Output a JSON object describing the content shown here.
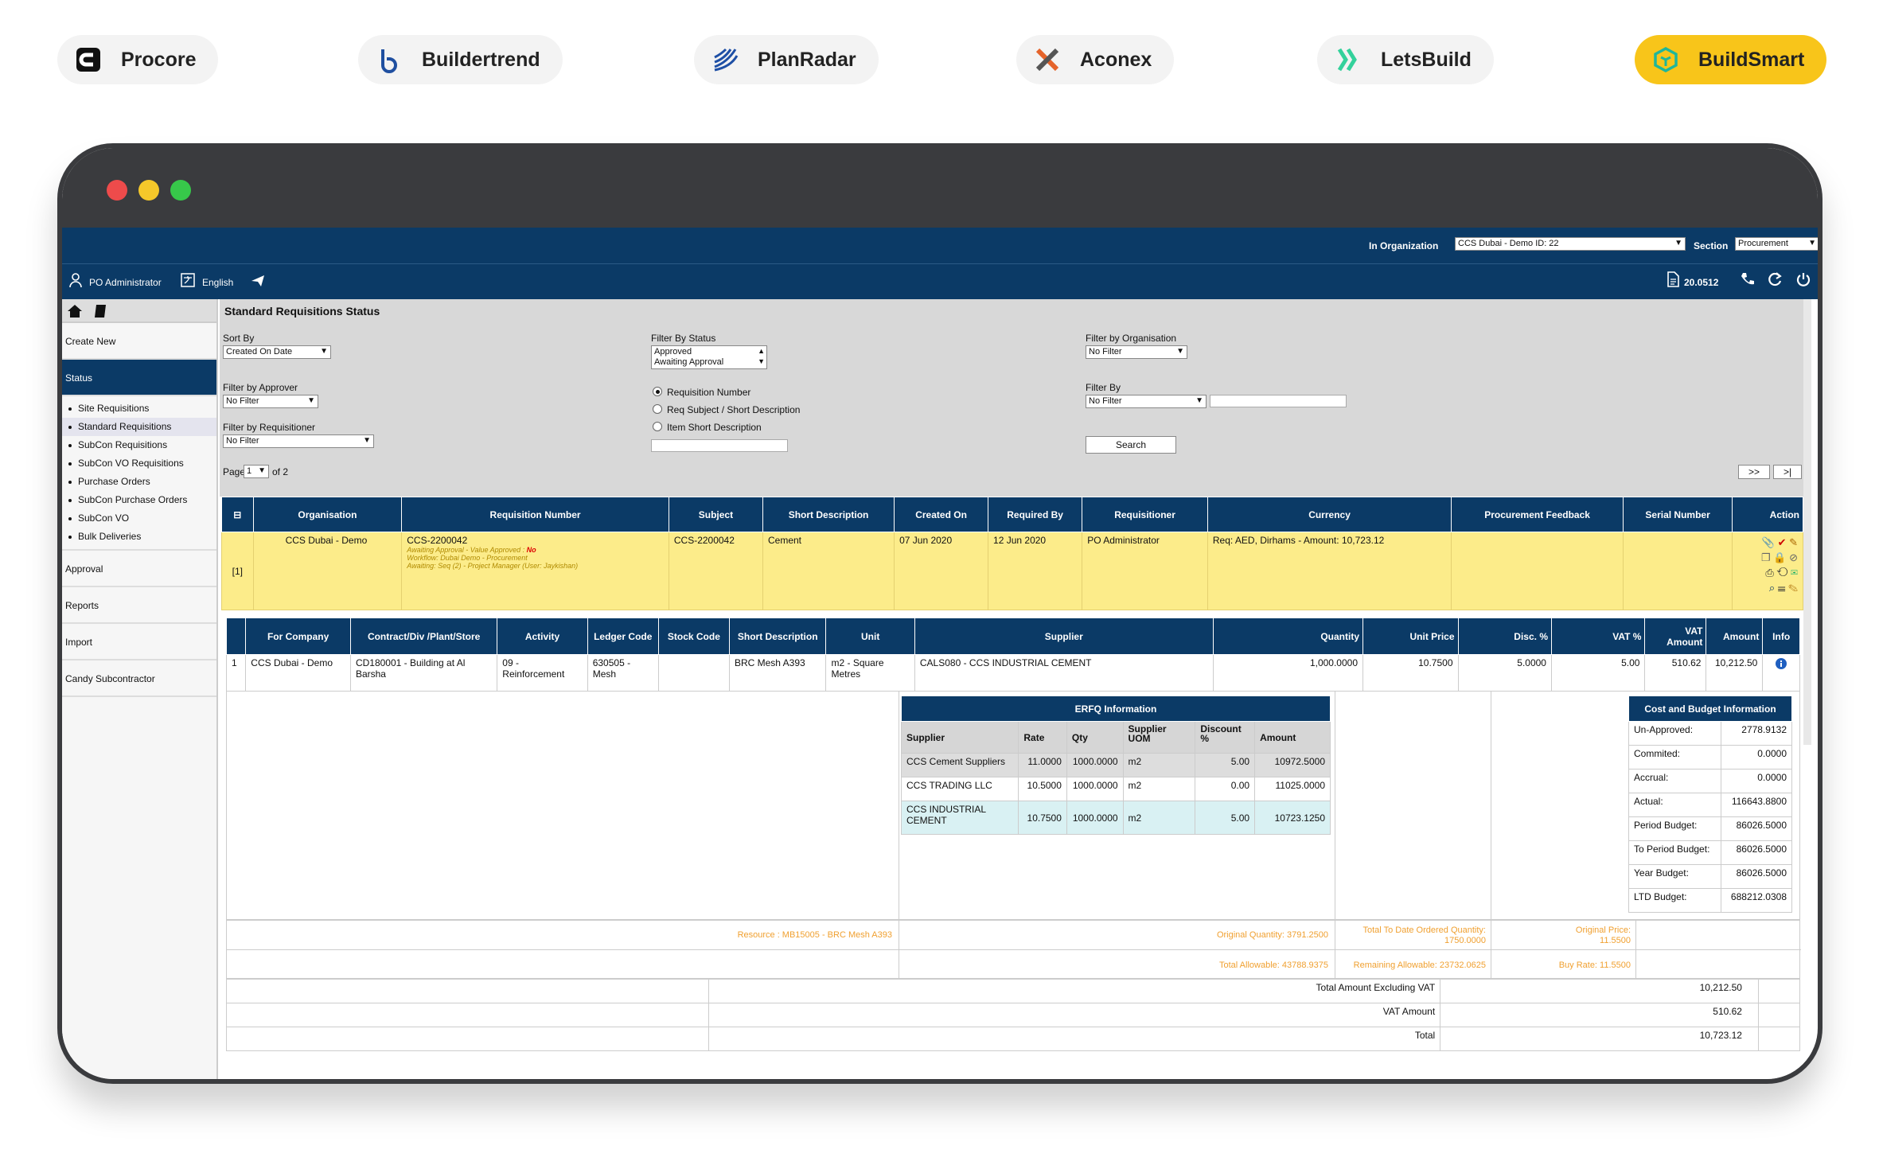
{
  "top_tabs": [
    {
      "label": "Procore",
      "color": "#111111",
      "icon": "procore-logo-icon"
    },
    {
      "label": "Buildertrend",
      "color": "#1f4fa0",
      "icon": "buildertrend-logo-icon"
    },
    {
      "label": "PlanRadar",
      "color": "#1e4fa5",
      "icon": "planradar-logo-icon"
    },
    {
      "label": "Aconex",
      "color": "#e5632a",
      "icon": "aconex-logo-icon"
    },
    {
      "label": "LetsBuild",
      "color": "#33d19b",
      "icon": "letsbuild-logo-icon"
    },
    {
      "label": "BuildSmart",
      "color": "#1fb69a",
      "icon": "buildsmart-logo-icon",
      "active": true
    }
  ],
  "orgbar": {
    "org_label": "In Organization",
    "org_value": "CCS Dubai - Demo ID: 22",
    "section_label": "Section",
    "section_value": "Procurement"
  },
  "userbar": {
    "user": "PO Administrator",
    "language": "English",
    "version": "20.0512"
  },
  "sidebar": {
    "create_new": "Create New",
    "status": "Status",
    "subs": [
      "Site Requisitions",
      "Standard Requisitions",
      "SubCon Requisitions",
      "SubCon VO Requisitions",
      "Purchase Orders",
      "SubCon Purchase Orders",
      "SubCon VO",
      "Bulk Deliveries"
    ],
    "approval": "Approval",
    "reports": "Reports",
    "import": "Import",
    "candy": "Candy Subcontractor"
  },
  "page_title": "Standard Requisitions Status",
  "filters": {
    "sort_by_label": "Sort By",
    "sort_by_value": "Created On Date",
    "filter_status_label": "Filter By Status",
    "status_options": [
      "Approved",
      "Awaiting Approval"
    ],
    "filter_org_label": "Filter by Organisation",
    "filter_org_value": "No Filter",
    "filter_approver_label": "Filter by Approver",
    "filter_approver_value": "No Filter",
    "radio1": "Requisition Number",
    "radio2": "Req Subject / Short Description",
    "radio3": "Item Short Description",
    "filter_by_label": "Filter By",
    "filter_by_value": "No Filter",
    "filter_req_label": "Filter by Requisitioner",
    "filter_req_value": "No Filter",
    "search": "Search",
    "page_label": "Page",
    "page_value": "1",
    "page_of": "of 2",
    "next": ">>",
    "last": ">|"
  },
  "main_table": {
    "headers": [
      "Organisation",
      "Requisition Number",
      "Subject",
      "Short Description",
      "Created On",
      "Required By",
      "Requisitioner",
      "Currency",
      "Procurement Feedback",
      "Serial Number",
      "Action"
    ],
    "row": {
      "index": "[1]",
      "org": "CCS Dubai - Demo",
      "req_no": "CCS-2200042",
      "status_line": "Awaiting Approval - Value Approved : ",
      "status_no": "No",
      "workflow": "Workflow: Dubai Demo - Procurement",
      "awaiting": "Awaiting: Seq (2) - Project Manager (User: Jaykishan)",
      "subject": "CCS-2200042",
      "short_desc": "Cement",
      "created": "07 Jun 2020",
      "required": "12 Jun 2020",
      "requisitioner": "PO Administrator",
      "currency": "Req: AED, Dirhams - Amount: 10,723.12"
    }
  },
  "items_table": {
    "headers": [
      "For Company",
      "Contract/Div /Plant/Store",
      "Activity",
      "Ledger Code",
      "Stock Code",
      "Short Description",
      "Unit",
      "Supplier",
      "Quantity",
      "Unit Price",
      "Disc. %",
      "VAT %",
      "VAT Amount",
      "Amount",
      "Info"
    ],
    "row": [
      "1",
      "CCS Dubai - Demo",
      "CD180001 - Building at Al Barsha",
      "09 - Reinforcement",
      "630505 - Mesh",
      "",
      "BRC Mesh A393",
      "m2 - Square Metres",
      "CALS080 - CCS INDUSTRIAL CEMENT",
      "1,000.0000",
      "10.7500",
      "5.0000",
      "5.00",
      "510.62",
      "10,212.50"
    ]
  },
  "erfq": {
    "title": "ERFQ Information",
    "headers": [
      "Supplier",
      "Rate",
      "Qty",
      "Supplier UOM",
      "Discount %",
      "Amount"
    ],
    "rows": [
      [
        "CCS Cement Suppliers",
        "11.0000",
        "1000.0000",
        "m2",
        "5.00",
        "10972.5000"
      ],
      [
        "CCS TRADING LLC",
        "10.5000",
        "1000.0000",
        "m2",
        "0.00",
        "11025.0000"
      ],
      [
        "CCS INDUSTRIAL CEMENT",
        "10.7500",
        "1000.0000",
        "m2",
        "5.00",
        "10723.1250"
      ]
    ]
  },
  "cost_budget": {
    "title": "Cost and Budget Information",
    "rows": [
      [
        "Un-Approved:",
        "2778.9132"
      ],
      [
        "Commited:",
        "0.0000"
      ],
      [
        "Accrual:",
        "0.0000"
      ],
      [
        "Actual:",
        "116643.8800"
      ],
      [
        "Period Budget:",
        "86026.5000"
      ],
      [
        "To Period Budget:",
        "86026.5000"
      ],
      [
        "Year Budget:",
        "86026.5000"
      ],
      [
        "LTD Budget:",
        "688212.0308"
      ]
    ]
  },
  "resource_info": {
    "resource": "Resource : MB15005 - BRC Mesh A393",
    "orig_qty": "Original Quantity: 3791.2500",
    "total_ordered": "Total To Date Ordered Quantity: 1750.0000",
    "orig_price": "Original Price: 11.5500",
    "total_allowable": "Total Allowable: 43788.9375",
    "remaining": "Remaining Allowable: 23732.0625",
    "buy_rate": "Buy Rate: 11.5500"
  },
  "totals": [
    [
      "Total Amount Excluding VAT",
      "10,212.50"
    ],
    [
      "VAT Amount",
      "510.62"
    ],
    [
      "Total",
      "10,723.12"
    ]
  ]
}
